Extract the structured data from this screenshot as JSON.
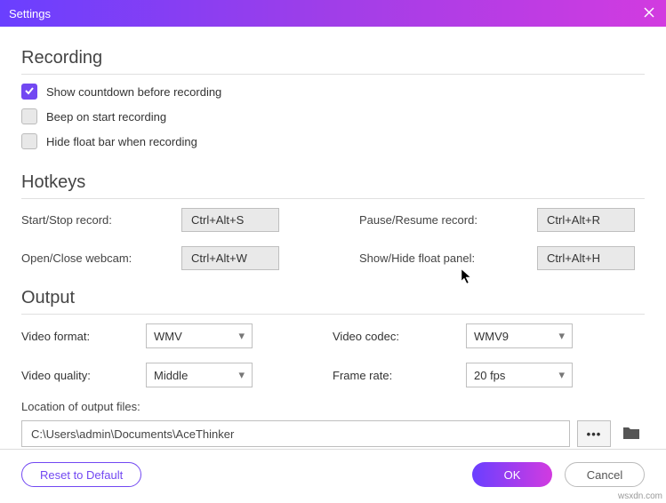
{
  "titlebar": {
    "title": "Settings"
  },
  "recording": {
    "heading": "Recording",
    "opts": [
      {
        "label": "Show countdown before recording",
        "checked": true
      },
      {
        "label": "Beep on start recording",
        "checked": false
      },
      {
        "label": "Hide float bar when recording",
        "checked": false
      }
    ]
  },
  "hotkeys": {
    "heading": "Hotkeys",
    "items": [
      {
        "label": "Start/Stop record:",
        "value": "Ctrl+Alt+S"
      },
      {
        "label": "Pause/Resume record:",
        "value": "Ctrl+Alt+R"
      },
      {
        "label": "Open/Close webcam:",
        "value": "Ctrl+Alt+W"
      },
      {
        "label": "Show/Hide float panel:",
        "value": "Ctrl+Alt+H"
      }
    ]
  },
  "output": {
    "heading": "Output",
    "videoFormatLabel": "Video format:",
    "videoFormatValue": "WMV",
    "videoCodecLabel": "Video codec:",
    "videoCodecValue": "WMV9",
    "videoQualityLabel": "Video quality:",
    "videoQualityValue": "Middle",
    "frameRateLabel": "Frame rate:",
    "frameRateValue": "20 fps",
    "locationLabel": "Location of output files:",
    "locationValue": "C:\\Users\\admin\\Documents\\AceThinker",
    "browseDots": "•••"
  },
  "footer": {
    "reset": "Reset to Default",
    "ok": "OK",
    "cancel": "Cancel"
  },
  "watermark": "wsxdn.com"
}
